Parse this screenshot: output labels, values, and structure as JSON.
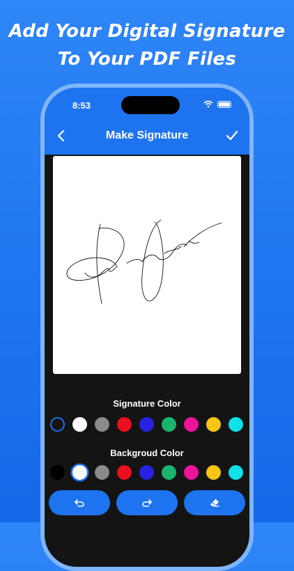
{
  "promo": {
    "line1": "Add Your Digital Signature",
    "line2": "To Your PDF Files"
  },
  "status_bar": {
    "time": "8:53"
  },
  "nav": {
    "title": "Make Signature",
    "back_icon": "chevron-left-icon",
    "done_icon": "checkmark-icon"
  },
  "signature_color": {
    "label": "Signature Color",
    "swatches": [
      "#141414",
      "#ffffff",
      "#8a8a8a",
      "#e8101e",
      "#2723e0",
      "#1bb46e",
      "#ea149a",
      "#f7c515",
      "#12e0e8"
    ],
    "selected_index": 0
  },
  "background_color": {
    "label": "Backgroud Color",
    "swatches": [
      "#000000",
      "#ffffff",
      "#8a8a8a",
      "#e8101e",
      "#2723e0",
      "#1bb46e",
      "#ea149a",
      "#f7c515",
      "#12e0e8"
    ],
    "selected_index": 1
  },
  "actions": {
    "undo_icon": "undo-icon",
    "redo_icon": "redo-icon",
    "eraser_icon": "eraser-icon"
  },
  "colors": {
    "accent": "#1e74ef",
    "background": "#141414"
  }
}
